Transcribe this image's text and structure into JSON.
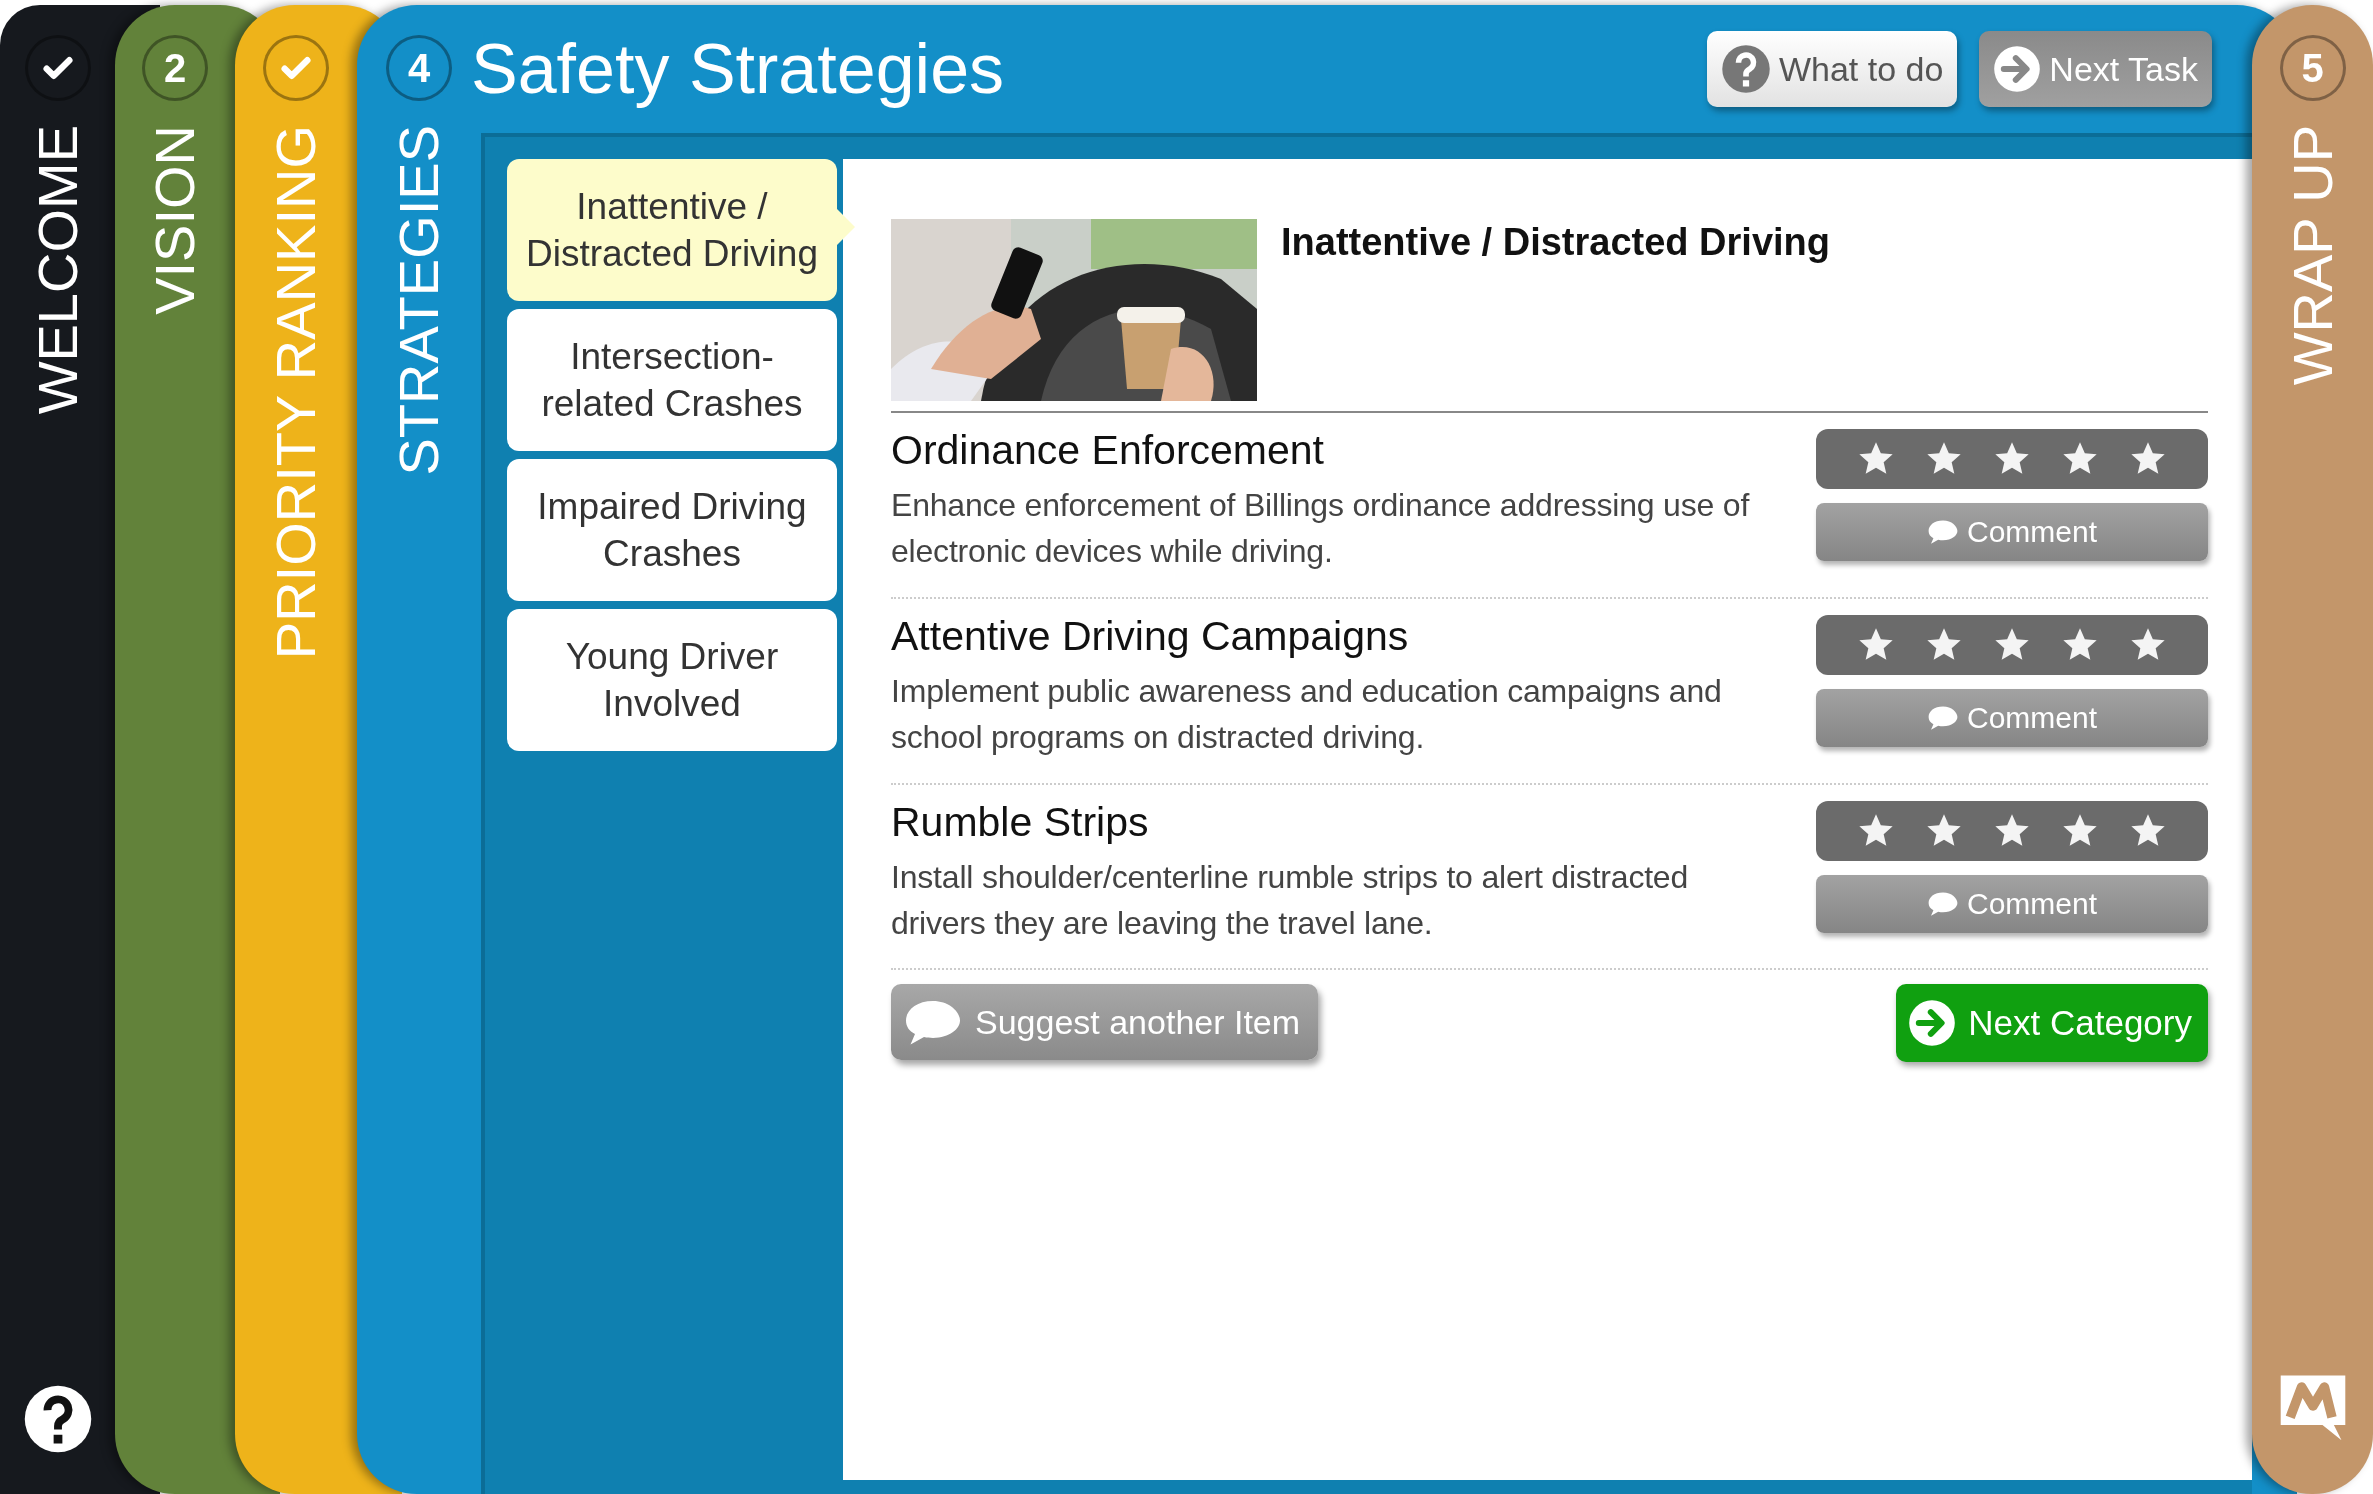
{
  "stages": [
    {
      "label": "WELCOME",
      "completed": true,
      "color": "#16191e"
    },
    {
      "label": "VISION",
      "number": "2",
      "completed": false,
      "color": "#62823a"
    },
    {
      "label": "PRIORITY RANKING",
      "completed": true,
      "color": "#eeb31a"
    },
    {
      "label": "STRATEGIES",
      "number": "4",
      "completed": false,
      "color": "#138fc8",
      "current": true
    },
    {
      "label": "WRAP UP",
      "number": "5",
      "completed": false,
      "color": "#c3966a"
    }
  ],
  "page": {
    "title": "Safety Strategies",
    "buttons": [
      {
        "label": "What to do",
        "kind": "help"
      },
      {
        "label": "Next Task",
        "kind": "next"
      }
    ]
  },
  "categories": [
    {
      "label": "Inattentive / Distracted Driving",
      "selected": true
    },
    {
      "label": "Intersection-related Crashes",
      "selected": false
    },
    {
      "label": "Impaired Driving Crashes",
      "selected": false
    },
    {
      "label": "Young Driver Involved",
      "selected": false
    }
  ],
  "category": {
    "heading": "Inattentive / Distracted Driving"
  },
  "strategies": [
    {
      "title": "Ordinance Enforcement",
      "description": "Enhance enforcement of Billings ordinance addressing use of electronic devices while driving.",
      "stars": 5,
      "comment_label": "Comment"
    },
    {
      "title": "Attentive Driving Campaigns",
      "description": "Implement public awareness and education campaigns and school programs on distracted driving.",
      "stars": 5,
      "comment_label": "Comment"
    },
    {
      "title": "Rumble Strips",
      "description": "Install shoulder/centerline rumble strips to alert distracted drivers they are leaving the travel lane.",
      "stars": 5,
      "comment_label": "Comment"
    }
  ],
  "suggest_button": "Suggest another Item",
  "next_category_button": "Next Category"
}
